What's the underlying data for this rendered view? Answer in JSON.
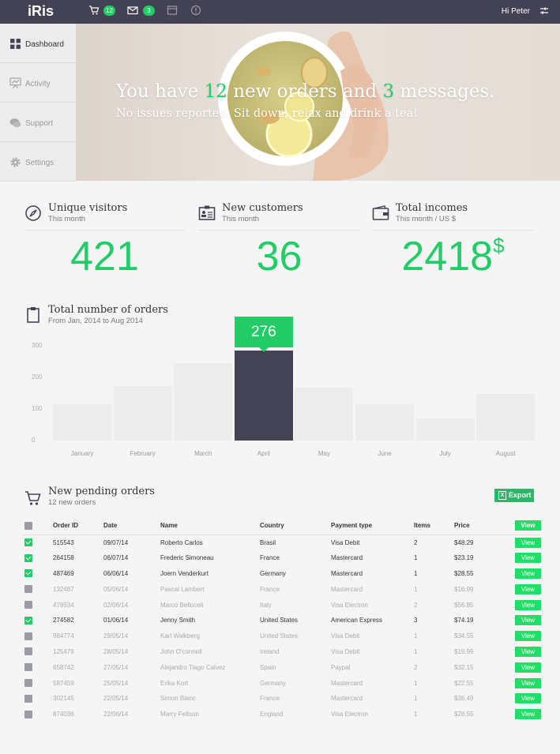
{
  "topbar": {
    "logo": "iRis",
    "cart_count": "12",
    "mail_count": "3",
    "greeting": "Hi Peter"
  },
  "sidebar": {
    "items": [
      {
        "label": "Dashboard",
        "icon": "grid-icon"
      },
      {
        "label": "Activity",
        "icon": "presentation-icon"
      },
      {
        "label": "Support",
        "icon": "chat-bubbles-icon"
      },
      {
        "label": "Settings",
        "icon": "gear-icon"
      }
    ]
  },
  "hero": {
    "line1_a": "You have ",
    "line1_orders": "12",
    "line1_b": " new orders and ",
    "line1_messages": "3",
    "line1_c": " messages.",
    "line2": "No issues reported. Sit down, relax and drink a tea!"
  },
  "stats": [
    {
      "title": "Unique visitors",
      "subtitle": "This month",
      "value": "421",
      "suffix": ""
    },
    {
      "title": "New customers",
      "subtitle": "This month",
      "value": "36",
      "suffix": ""
    },
    {
      "title": "Total incomes",
      "subtitle": "This month / US $",
      "value": "2418",
      "suffix": "$"
    }
  ],
  "orders_chart": {
    "title": "Total number of orders",
    "subtitle": "From Jan, 2014 to Aug 2014",
    "highlight_label": "276"
  },
  "chart_data": {
    "type": "bar",
    "title": "Total number of orders",
    "categories": [
      "January",
      "February",
      "March",
      "April",
      "May",
      "June",
      "July",
      "August"
    ],
    "values": [
      115,
      172,
      245,
      285,
      167,
      115,
      70,
      148
    ],
    "yticks": [
      "300",
      "200",
      "100",
      "0"
    ],
    "ylim": [
      0,
      300
    ],
    "highlight": "April",
    "colors": {
      "bar": "#ececec",
      "highlight": "#444356",
      "tooltip": "#22cc66"
    }
  },
  "pending": {
    "title": "New pending orders",
    "subtitle": "12 new orders",
    "export_label": "Export",
    "view_label": "View",
    "columns": [
      "Order ID",
      "Date",
      "Name",
      "Country",
      "Payment type",
      "Items",
      "Price"
    ],
    "rows": [
      {
        "checked": true,
        "id": "515543",
        "date": "09/07/14",
        "name": "Roberto Carlos",
        "country": "Brasil",
        "payment": "Visa Debit",
        "items": "2",
        "price": "$48.29"
      },
      {
        "checked": true,
        "id": "264158",
        "date": "06/07/14",
        "name": "Frederic Simoneau",
        "country": "France",
        "payment": "Mastercard",
        "items": "1",
        "price": "$23.19"
      },
      {
        "checked": true,
        "id": "487469",
        "date": "06/06/14",
        "name": "Joern Venderkurt",
        "country": "Germany",
        "payment": "Mastercard",
        "items": "1",
        "price": "$28.55"
      },
      {
        "checked": false,
        "id": "132487",
        "date": "05/06/14",
        "name": "Pascal Lambert",
        "country": "France",
        "payment": "Mastercard",
        "items": "1",
        "price": "$16.99"
      },
      {
        "checked": false,
        "id": "478934",
        "date": "02/06/14",
        "name": "Marco Belloceli",
        "country": "Italy",
        "payment": "Visa Electron",
        "items": "2",
        "price": "$56.85"
      },
      {
        "checked": true,
        "id": "274582",
        "date": "01/06/14",
        "name": "Jenny Smith",
        "country": "United States",
        "payment": "American Express",
        "items": "3",
        "price": "$74.19"
      },
      {
        "checked": false,
        "id": "984774",
        "date": "29/05/14",
        "name": "Karl Walkberg",
        "country": "United States",
        "payment": "Visa Debit",
        "items": "1",
        "price": "$34.55"
      },
      {
        "checked": false,
        "id": "125479",
        "date": "28/05/14",
        "name": "John O'connell",
        "country": "Ireland",
        "payment": "Visa Debit",
        "items": "1",
        "price": "$19.99"
      },
      {
        "checked": false,
        "id": "658742",
        "date": "27/05/14",
        "name": "Alejandro Tiago Calvez",
        "country": "Spain",
        "payment": "Paypal",
        "items": "2",
        "price": "$32.15"
      },
      {
        "checked": false,
        "id": "587459",
        "date": "25/05/14",
        "name": "Erika Kort",
        "country": "Germany",
        "payment": "Mastercard",
        "items": "1",
        "price": "$22.55"
      },
      {
        "checked": false,
        "id": "302145",
        "date": "22/05/14",
        "name": "Simon Blanc",
        "country": "France",
        "payment": "Mastercard",
        "items": "1",
        "price": "$36.49"
      },
      {
        "checked": false,
        "id": "874036",
        "date": "22/06/14",
        "name": "Marry Feltson",
        "country": "England",
        "payment": "Visa Electron",
        "items": "1",
        "price": "$28.55"
      }
    ]
  }
}
